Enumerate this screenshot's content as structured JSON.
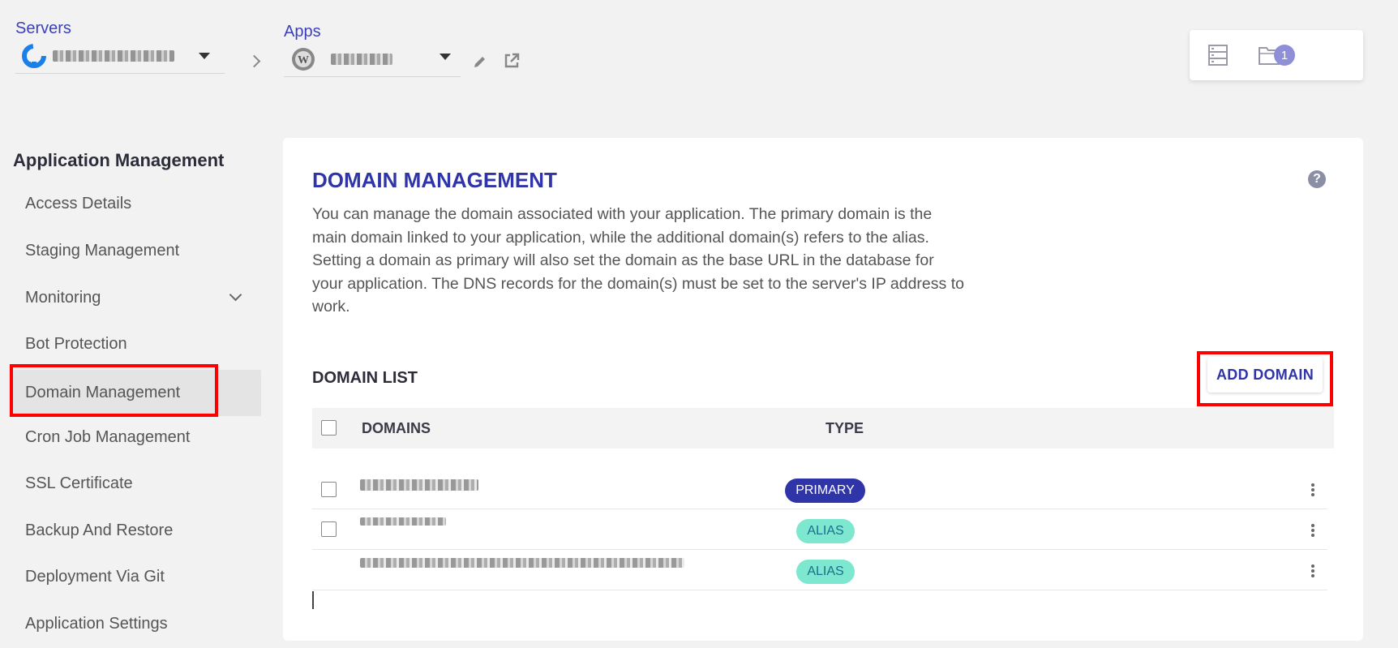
{
  "header": {
    "servers_label": "Servers",
    "apps_label": "Apps",
    "notification_count": "1"
  },
  "sidebar": {
    "title": "Application Management",
    "items": [
      {
        "label": "Access Details"
      },
      {
        "label": "Staging Management"
      },
      {
        "label": "Monitoring"
      },
      {
        "label": "Bot Protection"
      },
      {
        "label": "Domain Management"
      },
      {
        "label": "Cron Job Management"
      },
      {
        "label": "SSL Certificate"
      },
      {
        "label": "Backup And Restore"
      },
      {
        "label": "Deployment Via Git"
      },
      {
        "label": "Application Settings"
      }
    ],
    "active_item": "Domain Management"
  },
  "main": {
    "title": "DOMAIN MANAGEMENT",
    "description": "You can manage the domain associated with your application. The primary domain is the main domain linked to your application, while the additional domain(s) refers to the alias. Setting a domain as primary will also set the domain as the base URL in the database for your application. The DNS records for the domain(s) must be set to the server's IP address to work.",
    "help_icon": "?",
    "list_title": "DOMAIN LIST",
    "add_button": "ADD DOMAIN",
    "table": {
      "columns": [
        "DOMAINS",
        "TYPE"
      ],
      "rows": [
        {
          "type": "PRIMARY"
        },
        {
          "type": "ALIAS"
        },
        {
          "type": "ALIAS"
        }
      ]
    }
  },
  "colors": {
    "accent": "#2f34a8",
    "alias_tag": "#7de8cf",
    "highlight": "#ff0000"
  }
}
